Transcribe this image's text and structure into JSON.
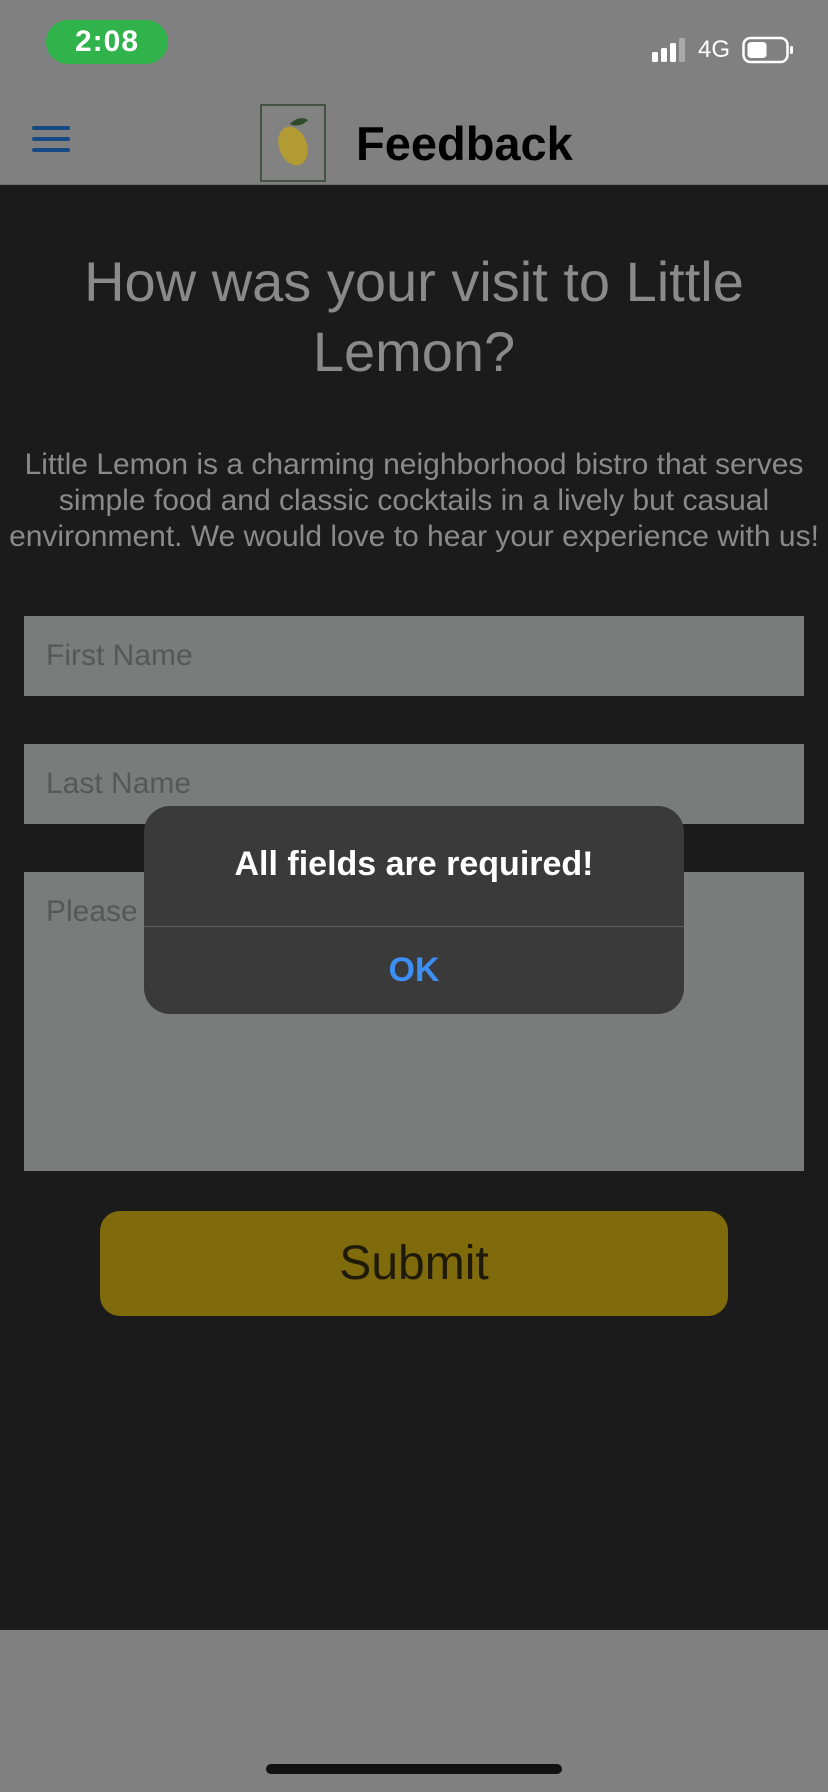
{
  "status_bar": {
    "time": "2:08",
    "network": "4G",
    "icons": [
      "signal-icon",
      "battery-icon"
    ]
  },
  "header": {
    "title": "Feedback",
    "menu_icon": "hamburger-menu-icon",
    "logo_icon": "lemon-logo-icon"
  },
  "main": {
    "heading": "How was your visit to Little Lemon?",
    "description": "Little Lemon is a charming neighborhood bistro that serves simple food and classic cocktails in a lively but casual environment. We would love to hear your experience with us!",
    "form": {
      "first_name_placeholder": "First Name",
      "last_name_placeholder": "Last Name",
      "message_placeholder": "Please",
      "submit_label": "Submit"
    }
  },
  "alert": {
    "message": "All fields are required!",
    "ok_label": "OK"
  },
  "colors": {
    "status_pill": "#2fb34a",
    "alert_button": "#3d8ff5",
    "submit_button": "#7f6b0b",
    "background_overlay": "#1b1b1b"
  }
}
